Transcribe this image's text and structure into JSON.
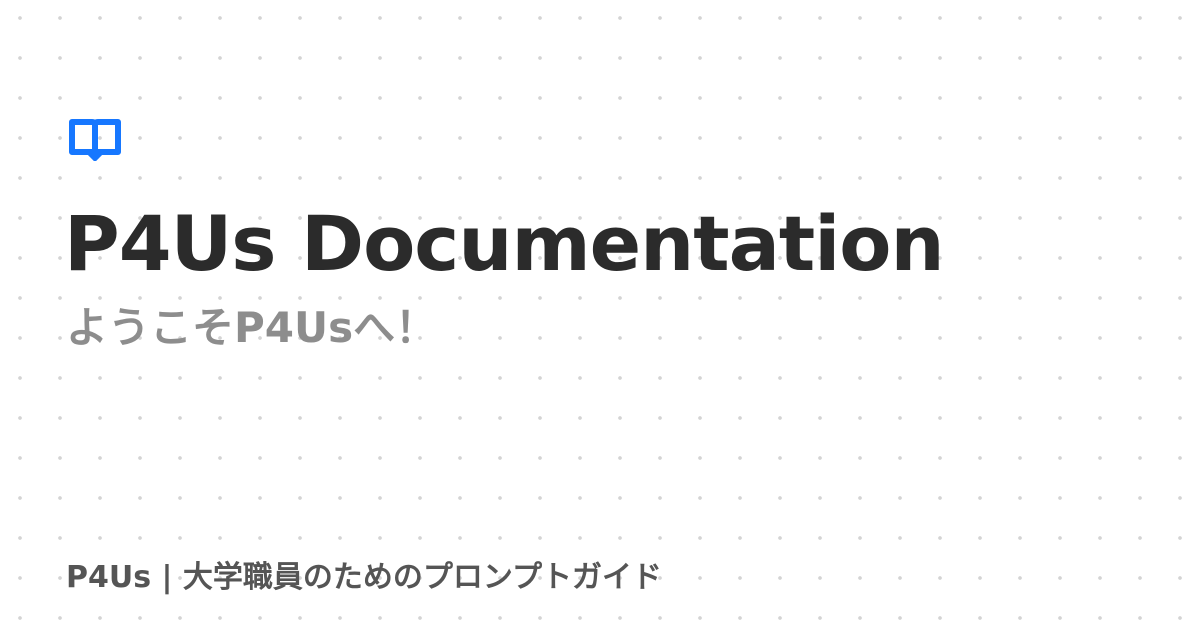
{
  "card": {
    "icon": "open-book-icon",
    "accent_color": "#1677ff",
    "title": "P4Us Documentation",
    "subtitle": "ようこそP4Usへ！",
    "footer": "P4Us | 大学職員のためのプロンプトガイド"
  }
}
